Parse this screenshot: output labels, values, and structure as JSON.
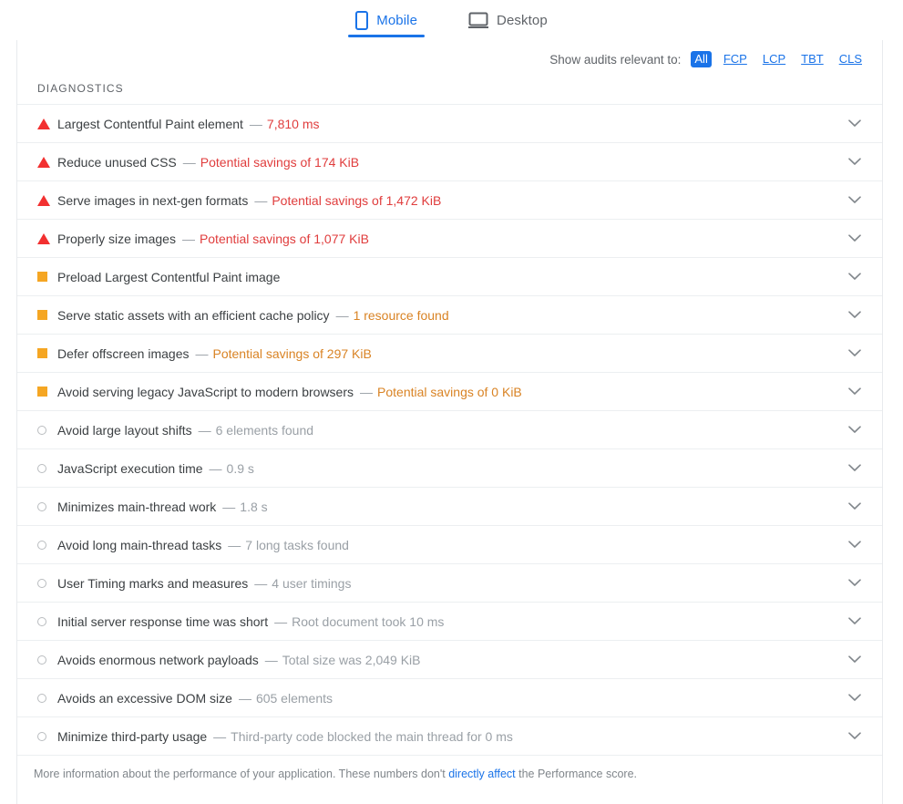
{
  "device_tabs": [
    {
      "label": "Mobile",
      "icon": "mobile-phone-icon",
      "active": true
    },
    {
      "label": "Desktop",
      "icon": "desktop-monitor-icon",
      "active": false
    }
  ],
  "filter": {
    "label": "Show audits relevant to:",
    "chips": [
      {
        "label": "All",
        "selected": true
      },
      {
        "label": "FCP",
        "selected": false
      },
      {
        "label": "LCP",
        "selected": false
      },
      {
        "label": "TBT",
        "selected": false
      },
      {
        "label": "CLS",
        "selected": false
      }
    ]
  },
  "section": {
    "heading": "DIAGNOSTICS"
  },
  "audits": [
    {
      "status": "fail",
      "title": "Largest Contentful Paint element",
      "sep": "—",
      "value": "7,810 ms"
    },
    {
      "status": "fail",
      "title": "Reduce unused CSS",
      "sep": "—",
      "value": "Potential savings of 174 KiB"
    },
    {
      "status": "fail",
      "title": "Serve images in next-gen formats",
      "sep": "—",
      "value": "Potential savings of 1,472 KiB"
    },
    {
      "status": "fail",
      "title": "Properly size images",
      "sep": "—",
      "value": "Potential savings of 1,077 KiB"
    },
    {
      "status": "average",
      "title": "Preload Largest Contentful Paint image",
      "sep": "",
      "value": ""
    },
    {
      "status": "average",
      "title": "Serve static assets with an efficient cache policy",
      "sep": "—",
      "value": "1 resource found"
    },
    {
      "status": "average",
      "title": "Defer offscreen images",
      "sep": "—",
      "value": "Potential savings of 297 KiB"
    },
    {
      "status": "average",
      "title": "Avoid serving legacy JavaScript to modern browsers",
      "sep": "—",
      "value": "Potential savings of 0 KiB"
    },
    {
      "status": "pass",
      "title": "Avoid large layout shifts",
      "sep": "—",
      "value": "6 elements found"
    },
    {
      "status": "pass",
      "title": "JavaScript execution time",
      "sep": "—",
      "value": "0.9 s"
    },
    {
      "status": "pass",
      "title": "Minimizes main-thread work",
      "sep": "—",
      "value": "1.8 s"
    },
    {
      "status": "pass",
      "title": "Avoid long main-thread tasks",
      "sep": "—",
      "value": "7 long tasks found"
    },
    {
      "status": "pass",
      "title": "User Timing marks and measures",
      "sep": "—",
      "value": "4 user timings"
    },
    {
      "status": "pass",
      "title": "Initial server response time was short",
      "sep": "—",
      "value": "Root document took 10 ms"
    },
    {
      "status": "pass",
      "title": "Avoids enormous network payloads",
      "sep": "—",
      "value": "Total size was 2,049 KiB"
    },
    {
      "status": "pass",
      "title": "Avoids an excessive DOM size",
      "sep": "—",
      "value": "605 elements"
    },
    {
      "status": "pass",
      "title": "Minimize third-party usage",
      "sep": "—",
      "value": "Third-party code blocked the main thread for 0 ms"
    }
  ],
  "footer": {
    "text_before": "More information about the performance of your application. These numbers don't ",
    "link_text": "directly affect",
    "text_after": " the Performance score."
  },
  "colors": {
    "accent_blue": "#1a73e8",
    "fail_red": "#f23030",
    "average_orange": "#f5a623",
    "pass_gray": "#b9bcbf",
    "fail_text": "#e03d3d",
    "average_text": "#d98324",
    "pass_text": "#9aa0a6"
  }
}
